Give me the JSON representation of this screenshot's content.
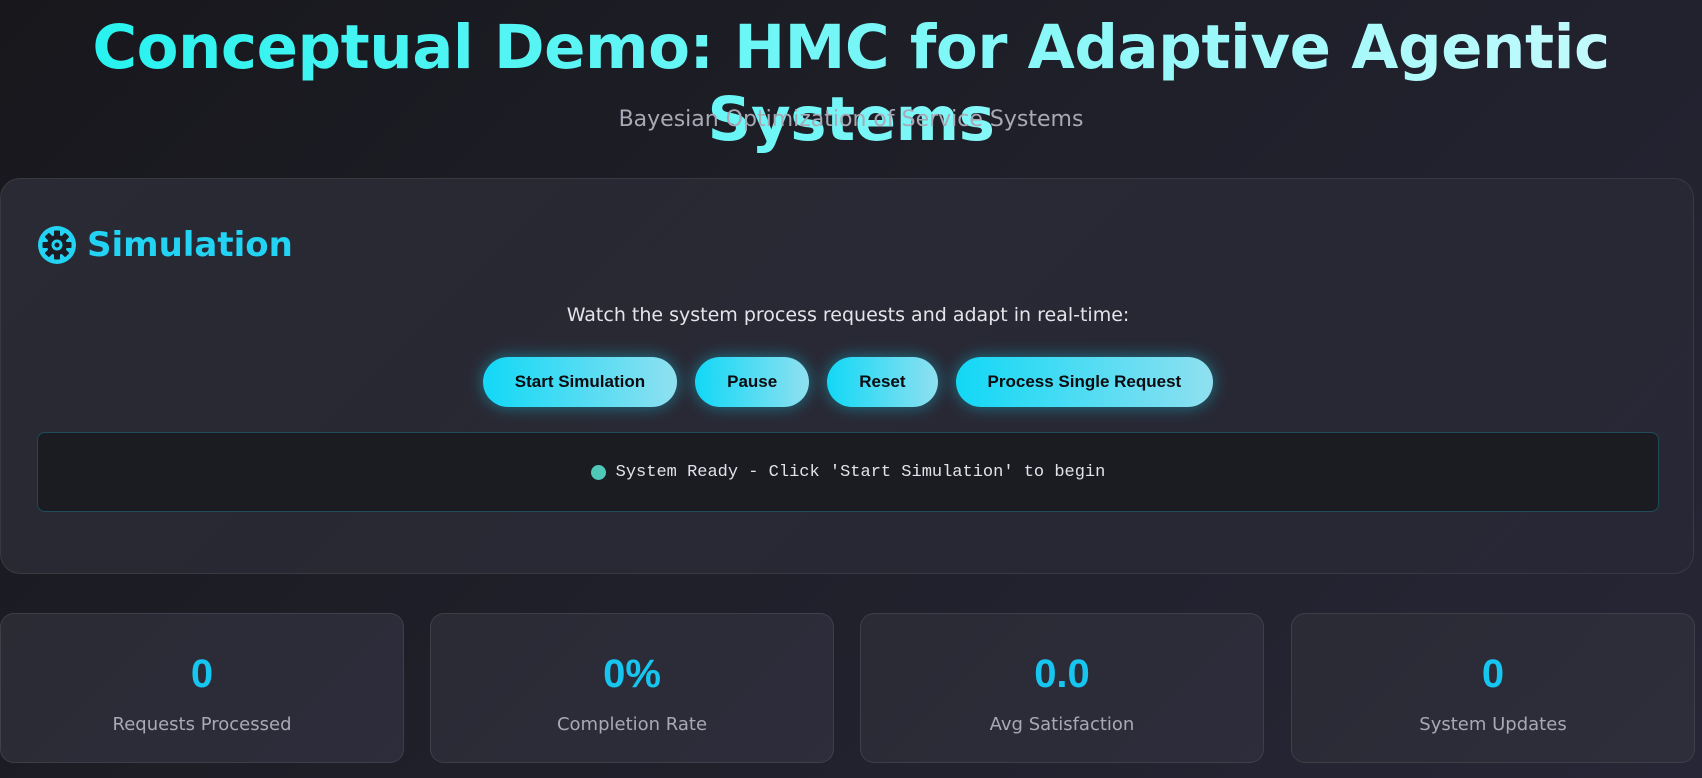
{
  "header": {
    "title": "Conceptual Demo: HMC for Adaptive Agentic Systems",
    "subtitle": "Bayesian Optimization of Service Systems"
  },
  "simulation": {
    "heading": "Simulation",
    "heading_icon": "gear-icon",
    "description": "Watch the system process requests and adapt in real-time:",
    "buttons": {
      "start": "Start Simulation",
      "pause": "Pause",
      "reset": "Reset",
      "single": "Process Single Request"
    },
    "status": {
      "text": "System Ready - Click 'Start Simulation' to begin",
      "indicator_color": "#4fc8b8"
    }
  },
  "stats": [
    {
      "value": "0",
      "label": "Requests Processed"
    },
    {
      "value": "0%",
      "label": "Completion Rate"
    },
    {
      "value": "0.0",
      "label": "Avg Satisfaction"
    },
    {
      "value": "0",
      "label": "System Updates"
    }
  ],
  "colors": {
    "accent": "#22d3f4",
    "button_gradient_start": "#12d8f6",
    "button_gradient_end": "#8fe0f0",
    "stat_value": "#16c6f0"
  }
}
